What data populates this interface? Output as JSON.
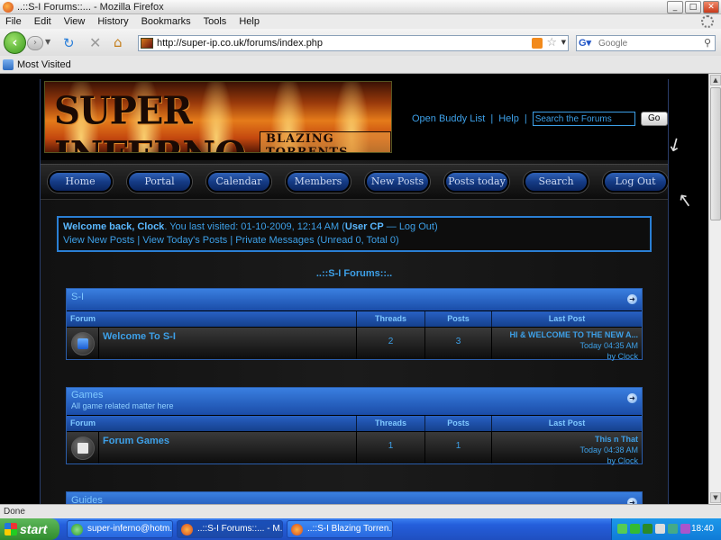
{
  "window": {
    "title": "..::S-I Forums::... - Mozilla Firefox"
  },
  "menu": [
    "File",
    "Edit",
    "View",
    "History",
    "Bookmarks",
    "Tools",
    "Help"
  ],
  "toolbar": {
    "url": "http://super-ip.co.uk/forums/index.php",
    "search_placeholder": "Google"
  },
  "bookmarks": {
    "most_visited": "Most Visited"
  },
  "site": {
    "logo_title": "SUPER INFERNO",
    "logo_subtitle": "BLAZING TORRENTS",
    "links": {
      "buddy": "Open Buddy List",
      "help": "Help",
      "sep": "|"
    },
    "search_placeholder": "Search the Forums",
    "go": "Go",
    "nav": [
      "Home",
      "Portal",
      "Calendar",
      "Members",
      "New Posts",
      "Posts today",
      "Search",
      "Log Out"
    ]
  },
  "welcome": {
    "prefix": "Welcome back, ",
    "user": "Clock",
    "visited": ". You last visited: 01-10-2009, 12:14 AM (",
    "usercp": "User CP",
    "dash": " — ",
    "logout": "Log Out",
    "close": ")",
    "line2": "View New Posts  |  View Today's Posts  |  Private Messages (Unread 0, Total 0)"
  },
  "heading": "..::S-I Forums::..",
  "columns": {
    "forum": "Forum",
    "threads": "Threads",
    "posts": "Posts",
    "last": "Last Post"
  },
  "categories": [
    {
      "name": "S-I",
      "desc": "",
      "forum": "Welcome To S-I",
      "threads": "2",
      "posts": "3",
      "last_title": "HI & WELCOME TO THE NEW A...",
      "last_time": "Today 04:35 AM",
      "last_by": "by Clock"
    },
    {
      "name": "Games",
      "desc": "All game related matter here",
      "forum": "Forum Games",
      "threads": "1",
      "posts": "1",
      "last_title": "This n That",
      "last_time": "Today 04:38 AM",
      "last_by": "by Clock"
    },
    {
      "name": "Guides"
    }
  ],
  "status": "Done",
  "taskbar": {
    "start": "start",
    "tasks": [
      "super-inferno@hotm...",
      "..::S-I Forums::... - M...",
      "..::S-I Blazing Torren..."
    ],
    "clock": "18:40"
  }
}
